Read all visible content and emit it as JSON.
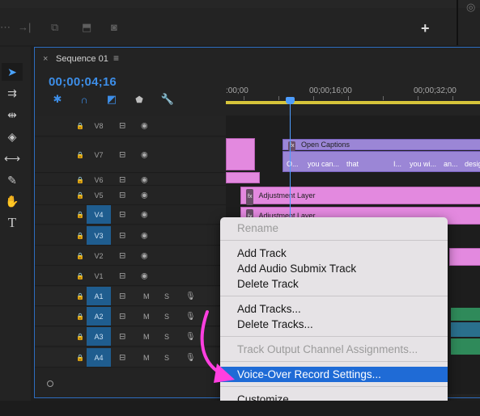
{
  "topbar": {
    "icons": [
      "transport-dots-icon",
      "insert-icon",
      "overwrite-icon",
      "lift-icon",
      "extract-icon",
      "export-frame-icon"
    ],
    "plus_label": "+"
  },
  "tools": [
    {
      "name": "selection-tool-icon",
      "glyph": "➤",
      "active": true
    },
    {
      "name": "track-select-tool-icon",
      "glyph": "⇉",
      "active": false
    },
    {
      "name": "ripple-edit-tool-icon",
      "glyph": "⇹",
      "active": false
    },
    {
      "name": "razor-tool-icon",
      "glyph": "◈",
      "active": false
    },
    {
      "name": "slip-tool-icon",
      "glyph": "⟷",
      "active": false
    },
    {
      "name": "pen-tool-icon",
      "glyph": "✎",
      "active": false
    },
    {
      "name": "hand-tool-icon",
      "glyph": "✋",
      "active": false
    },
    {
      "name": "type-tool-icon",
      "glyph": "T",
      "active": false
    }
  ],
  "sequence": {
    "close": "×",
    "title": "Sequence 01",
    "menu": "≡",
    "timecode": "00;00;04;16"
  },
  "ruler": {
    "labels": [
      ":00;00",
      "00;00;16;00",
      "00;00;32;00"
    ]
  },
  "tracks": [
    {
      "name": "V8",
      "targeted": false,
      "kind": "video"
    },
    {
      "name": "V7",
      "targeted": false,
      "kind": "video"
    },
    {
      "name": "V6",
      "targeted": false,
      "kind": "video"
    },
    {
      "name": "V5",
      "targeted": false,
      "kind": "video"
    },
    {
      "name": "V4",
      "targeted": true,
      "kind": "video"
    },
    {
      "name": "V3",
      "targeted": true,
      "kind": "video"
    },
    {
      "name": "V2",
      "targeted": false,
      "kind": "video"
    },
    {
      "name": "V1",
      "targeted": false,
      "kind": "video"
    },
    {
      "name": "A1",
      "targeted": true,
      "kind": "audio"
    },
    {
      "name": "A2",
      "targeted": true,
      "kind": "audio"
    },
    {
      "name": "A3",
      "targeted": true,
      "kind": "audio"
    },
    {
      "name": "A4",
      "targeted": true,
      "kind": "audio"
    }
  ],
  "audio_labels": {
    "mute": "M",
    "solo": "S"
  },
  "clips": {
    "captions_title": "Open Captions",
    "caption_words": [
      "O...",
      "you can...",
      "that",
      "I...",
      "you wi...",
      "an...",
      "desig"
    ],
    "adjustment_1": "Adjustment Layer",
    "adjustment_2": "Adjustment Layer",
    "fx": "fx"
  },
  "context_menu": {
    "items": [
      {
        "label": "Rename",
        "disabled": true
      },
      {
        "label": "Add Track",
        "disabled": false
      },
      {
        "label": "Add Audio Submix Track",
        "disabled": false
      },
      {
        "label": "Delete Track",
        "disabled": false
      },
      {
        "label": "Add Tracks...",
        "disabled": false
      },
      {
        "label": "Delete Tracks...",
        "disabled": false
      },
      {
        "label": "Track Output Channel Assignments...",
        "disabled": true
      },
      {
        "label": "Voice-Over Record Settings...",
        "disabled": false,
        "selected": true
      },
      {
        "label": "Customize...",
        "disabled": false
      }
    ]
  },
  "colors": {
    "accent": "#4d9dff",
    "menu_highlight": "#1f6bd6",
    "annotation_arrow": "#ff3fe0",
    "clip_pink": "#e389df",
    "clip_purple": "#9b86d6"
  }
}
